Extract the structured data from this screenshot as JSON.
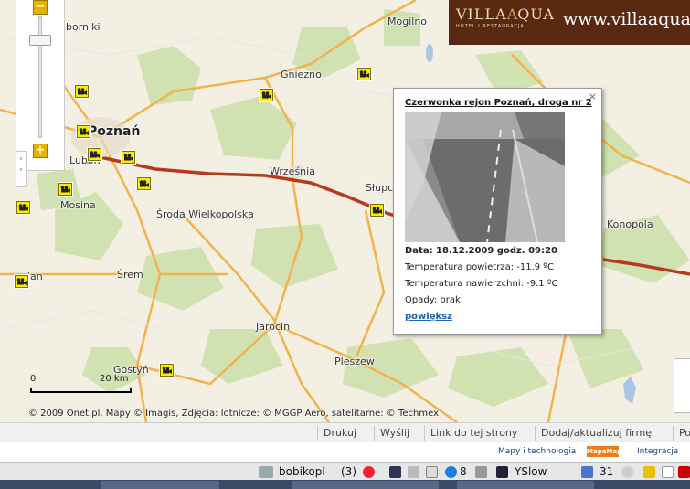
{
  "map": {
    "towns": [
      {
        "name": "Mogilno",
        "kind": "normal"
      },
      {
        "name": "Gniezno",
        "kind": "normal"
      },
      {
        "name": "Poznań",
        "kind": "big"
      },
      {
        "name": "Luboń",
        "kind": "normal"
      },
      {
        "name": "Września",
        "kind": "normal"
      },
      {
        "name": "Słupca",
        "kind": "normal"
      },
      {
        "name": "Mosina",
        "kind": "normal"
      },
      {
        "name": "Środa Wielkopolska",
        "kind": "normal"
      },
      {
        "name": "Śrem",
        "kind": "normal"
      },
      {
        "name": "Jarocin",
        "kind": "normal"
      },
      {
        "name": "Pleszew",
        "kind": "normal"
      },
      {
        "name": "Gostyń",
        "kind": "normal"
      },
      {
        "name": "Konopola",
        "kind": "normal"
      },
      {
        "name": "borniki",
        "kind": "normal"
      },
      {
        "name": "ian",
        "kind": "normal"
      }
    ],
    "camera_count": 14,
    "colors": {
      "land": "#f3efe3",
      "forest": "#cfe1b0",
      "road_main": "#b83a1c",
      "road_secondary": "#f3b24b",
      "water": "#a9c6e6"
    }
  },
  "zoom": {
    "plus": "+",
    "minus": "−",
    "level": 0.15
  },
  "popup": {
    "close": "×",
    "title": "Czerwonka rejon Poznań, droga nr 2",
    "date": "Data: 18.12.2009 godz. 09:20",
    "air_temp": "Temperatura powietrza: -11.9 ºC",
    "surface_temp": "Temperatura nawierzchni: -9.1 ºC",
    "precip": "Opady: brak",
    "enlarge": "powiększ"
  },
  "ad": {
    "brand_villa": "VILLA",
    "brand_aqua": "QUA",
    "brand_sub": "HOTEL I RESTAURACJA",
    "url": "www.villaaqua"
  },
  "scale": {
    "zero": "0",
    "length": "20 km"
  },
  "attribution": "© 2009 Onet.pl, Mapy © Imagis, Zdjęcia: lotnicze: © MGGP Aero, satelitarne: © Techmex",
  "toolbar": [
    "Drukuj",
    "Wyślij",
    "Link do tej strony",
    "Dodaj/aktualizuj firmę",
    "Po"
  ],
  "footer": {
    "links": [
      "Mapy i technologia",
      "Integracja"
    ],
    "logo": "MapaMap"
  },
  "status": {
    "user": "bobikopl",
    "count": "(3)",
    "mail_count": "8",
    "yslow": "YSlow",
    "date_num": "31"
  }
}
